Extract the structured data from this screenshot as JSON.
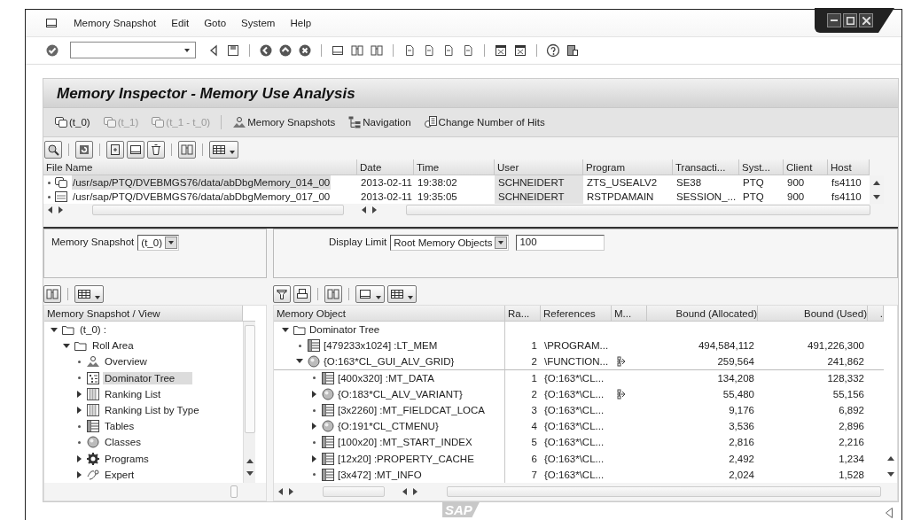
{
  "menu": [
    "Memory Snapshot",
    "Edit",
    "Goto",
    "System",
    "Help"
  ],
  "title": "Memory Inspector - Memory Use Analysis",
  "app_toolbar": [
    {
      "kind": "snapshot",
      "label": "(t_0)",
      "disabled": false
    },
    {
      "kind": "snapshot",
      "label": "(t_1)",
      "disabled": true
    },
    {
      "kind": "compare",
      "label": "(t_1 - t_0)",
      "disabled": true
    },
    {
      "kind": "snapshots",
      "label": "Memory Snapshots",
      "disabled": false
    },
    {
      "kind": "navigation",
      "label": "Navigation",
      "disabled": false
    },
    {
      "kind": "hits",
      "label": "Change Number of Hits",
      "disabled": false
    }
  ],
  "files": {
    "columns": [
      "File Name",
      "Date",
      "Time",
      "User",
      "Program",
      "Transacti...",
      "Syst...",
      "Client",
      "Host"
    ],
    "rows": [
      {
        "kind": "snapshot",
        "selected": true,
        "cells": [
          "/usr/sap/PTQ/DVEBMGS76/data/abDbgMemory_014_00",
          "2013-02-11",
          "19:38:02",
          "SCHNEIDERT",
          "ZTS_USEALV2",
          "SE38",
          "PTQ",
          "900",
          "fs4110"
        ]
      },
      {
        "kind": "xml",
        "selected": false,
        "cells": [
          "/usr/sap/PTQ/DVEBMGS76/data/abDbgMemory_017_00",
          "2013-02-11",
          "19:35:05",
          "SCHNEIDERT",
          "RSTPDAMAIN",
          "SESSION_...",
          "PTQ",
          "900",
          "fs4110"
        ]
      }
    ]
  },
  "selection": {
    "snapshot_label": "Memory Snapshot",
    "snapshot_value": "(t_0)",
    "limit_label": "Display Limit",
    "limit_value": "Root Memory Objects",
    "limit_count": "100"
  },
  "left_tree": {
    "header": "Memory Snapshot / View",
    "items": [
      {
        "kind": "folder",
        "label": "(t_0) :",
        "expandable": true,
        "expanded": true,
        "selected": false,
        "children": [
          {
            "kind": "folder",
            "label": "Roll Area",
            "expandable": true,
            "expanded": true,
            "selected": false,
            "children": [
              {
                "kind": "overview",
                "label": "Overview",
                "expandable": false,
                "expanded": false,
                "selected": false
              },
              {
                "kind": "tree",
                "label": "Dominator Tree",
                "expandable": false,
                "expanded": false,
                "selected": true
              },
              {
                "kind": "list",
                "label": "Ranking List",
                "expandable": true,
                "expanded": false,
                "selected": false
              },
              {
                "kind": "list",
                "label": "Ranking List by Type",
                "expandable": true,
                "expanded": false,
                "selected": false
              },
              {
                "kind": "table",
                "label": "Tables",
                "expandable": false,
                "expanded": false,
                "selected": false
              },
              {
                "kind": "class",
                "label": "Classes",
                "expandable": false,
                "expanded": false,
                "selected": false
              },
              {
                "kind": "program",
                "label": "Programs",
                "expandable": true,
                "expanded": false,
                "selected": false
              },
              {
                "kind": "expert",
                "label": "Expert",
                "expandable": true,
                "expanded": false,
                "selected": false
              }
            ]
          }
        ]
      }
    ]
  },
  "right_tree": {
    "columns": [
      "Memory Object",
      "Ra...",
      "References",
      "M...",
      "Bound (Allocated)",
      "Bound (Used)",
      "."
    ],
    "items": [
      {
        "kind": "folder",
        "label": "Dominator Tree",
        "expandable": true,
        "expanded": true,
        "children": [
          {
            "kind": "table",
            "label": "[479233x1024] :LT_MEM",
            "expandable": false,
            "expanded": false,
            "rank": "1",
            "references": "\\PROGRAM...",
            "linked": false,
            "allocated": "494,584,112",
            "used": "491,226,300"
          },
          {
            "kind": "class",
            "label": "{O:163*CL_GUI_ALV_GRID}",
            "expandable": true,
            "expanded": true,
            "rank": "2",
            "references": "\\FUNCTION...",
            "linked": true,
            "allocated": "259,564",
            "used": "241,862",
            "children": [
              {
                "kind": "table",
                "label": "[400x320] :MT_DATA",
                "expandable": false,
                "expanded": false,
                "rank": "1",
                "references": "{O:163*\\CL...",
                "linked": false,
                "allocated": "134,208",
                "used": "128,332"
              },
              {
                "kind": "class",
                "label": "{O:183*CL_ALV_VARIANT}",
                "expandable": true,
                "expanded": false,
                "rank": "2",
                "references": "{O:163*\\CL...",
                "linked": true,
                "allocated": "55,480",
                "used": "55,156"
              },
              {
                "kind": "table",
                "label": "[3x2260] :MT_FIELDCAT_LOCA",
                "expandable": false,
                "expanded": false,
                "rank": "3",
                "references": "{O:163*\\CL...",
                "linked": false,
                "allocated": "9,176",
                "used": "6,892"
              },
              {
                "kind": "class",
                "label": "{O:191*CL_CTMENU}",
                "expandable": true,
                "expanded": false,
                "rank": "4",
                "references": "{O:163*\\CL...",
                "linked": false,
                "allocated": "3,536",
                "used": "2,896"
              },
              {
                "kind": "table",
                "label": "[100x20] :MT_START_INDEX",
                "expandable": false,
                "expanded": false,
                "rank": "5",
                "references": "{O:163*\\CL...",
                "linked": false,
                "allocated": "2,816",
                "used": "2,216"
              },
              {
                "kind": "table",
                "label": "[12x20] :PROPERTY_CACHE",
                "expandable": true,
                "expanded": false,
                "rank": "6",
                "references": "{O:163*\\CL...",
                "linked": false,
                "allocated": "2,492",
                "used": "1,234"
              },
              {
                "kind": "table",
                "label": "[3x472] :MT_INFO",
                "expandable": false,
                "expanded": false,
                "rank": "7",
                "references": "{O:163*\\CL...",
                "linked": false,
                "allocated": "2,024",
                "used": "1,528"
              }
            ]
          }
        ]
      }
    ]
  },
  "logo": "SAP"
}
